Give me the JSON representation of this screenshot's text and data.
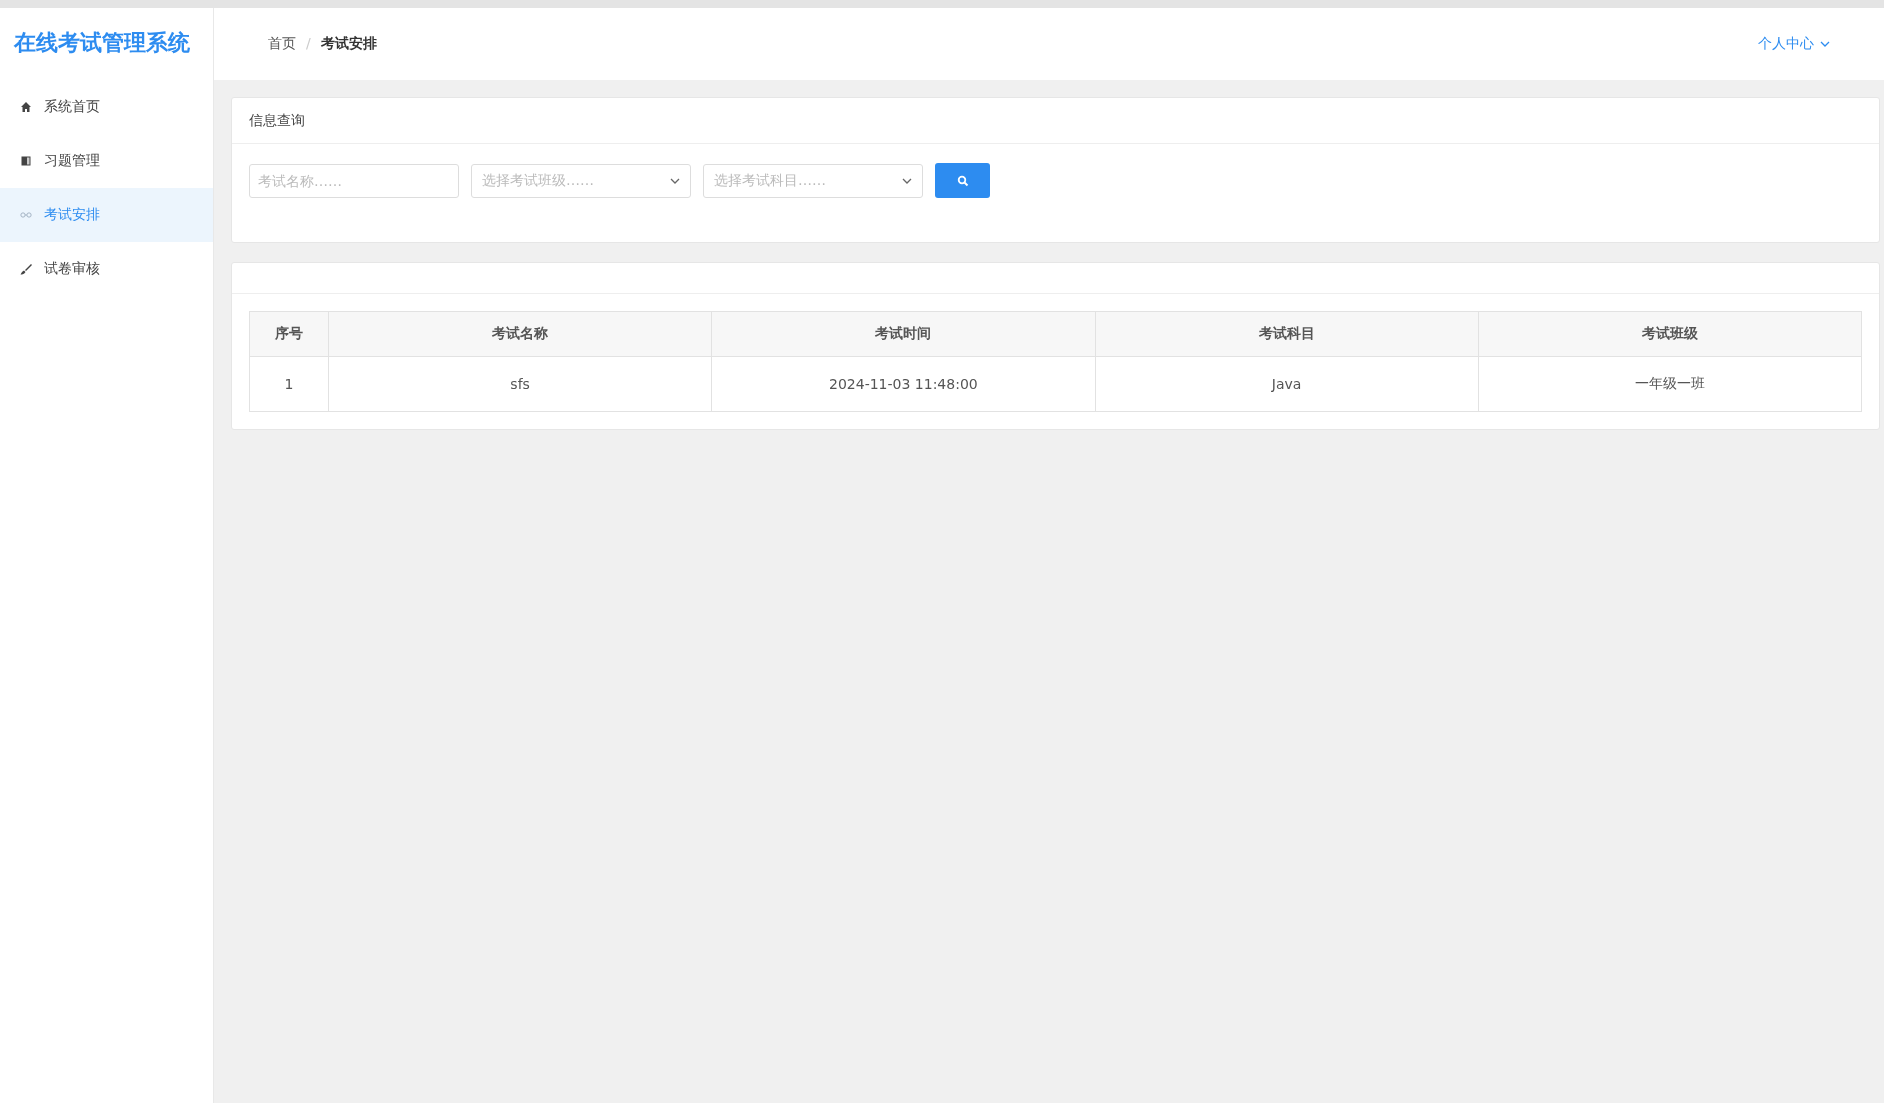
{
  "app_title": "在线考试管理系统",
  "sidebar": {
    "items": [
      {
        "label": "系统首页",
        "selected": false
      },
      {
        "label": "习题管理",
        "selected": false
      },
      {
        "label": "考试安排",
        "selected": true
      },
      {
        "label": "试卷审核",
        "selected": false
      }
    ]
  },
  "breadcrumb": [
    {
      "label": "首页",
      "current": false
    },
    {
      "label": "考试安排",
      "current": true
    }
  ],
  "breadcrumb_separator": "/",
  "user_menu": {
    "label": "个人中心"
  },
  "search_panel": {
    "title": "信息查询",
    "name_field": {
      "placeholder": "考试名称……"
    },
    "selects": [
      {
        "placeholder": "选择考试班级……"
      },
      {
        "placeholder": "选择考试科目……"
      }
    ]
  },
  "table": {
    "columns": [
      "序号",
      "考试名称",
      "考试时间",
      "考试科目",
      "考试班级"
    ],
    "rows": [
      [
        "1",
        "sfs",
        "2024-11-03 11:48:00",
        "Java",
        "一年级一班"
      ]
    ]
  }
}
